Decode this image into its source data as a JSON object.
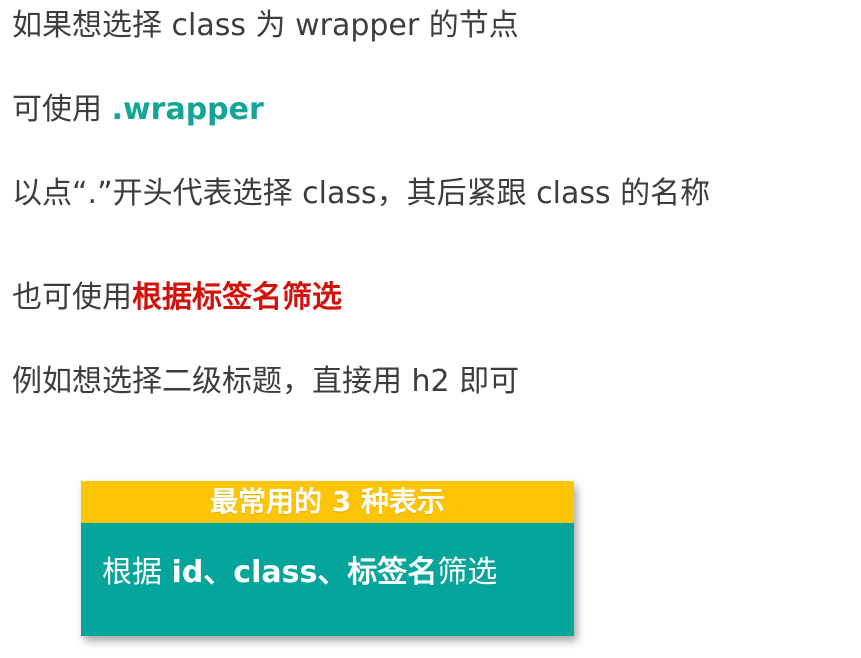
{
  "lines": {
    "line1": "如果想选择 class 为 wrapper 的节点",
    "line2_prefix": "可使用 ",
    "line2_highlight": ".wrapper",
    "line3": "以点“.”开头代表选择 class，其后紧跟 class 的名称",
    "line4_prefix": "也可使用",
    "line4_highlight": "根据标签名筛选",
    "line5": "例如想选择二级标题，直接用 h2 即可"
  },
  "card": {
    "header": "最常用的 3 种表示",
    "body_prefix": "根据 ",
    "body_bold": "id、class、标签名",
    "body_suffix": "筛选"
  },
  "colors": {
    "text": "#3d3d3d",
    "teal_highlight": "#13a595",
    "red_highlight": "#d4100b",
    "card_header_bg": "#fdc505",
    "card_body_bg": "#06a59c"
  }
}
